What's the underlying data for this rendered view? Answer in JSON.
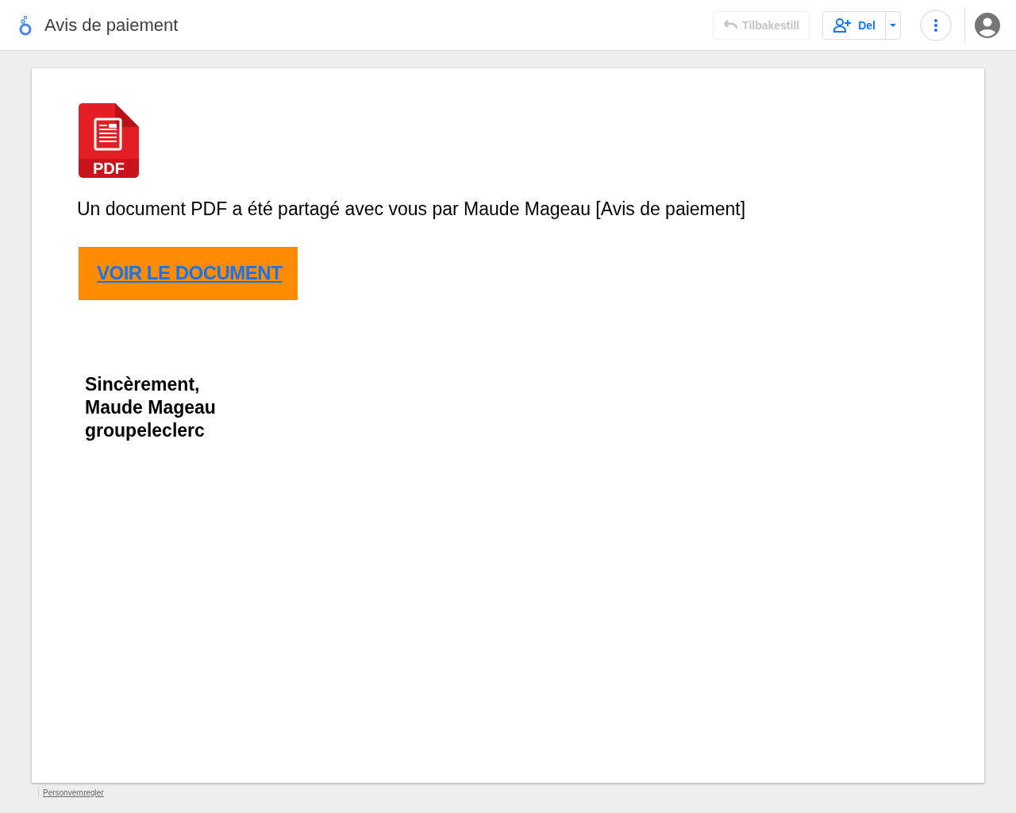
{
  "header": {
    "title": "Avis de paiement",
    "restore_button": {
      "label": "Tilbakestill",
      "disabled": true
    },
    "share_button": {
      "label": "Del"
    }
  },
  "document": {
    "file_icon_label": "PDF",
    "message": "Un document PDF a été partagé avec vous par Maude Mageau [Avis de paiement]",
    "link": "VOIR LE DOCUMENT",
    "signature": [
      "Sincèrement,",
      "Maude Mageau",
      "groupeleclerc"
    ]
  },
  "footer": {
    "link": "Personvernregler"
  }
}
